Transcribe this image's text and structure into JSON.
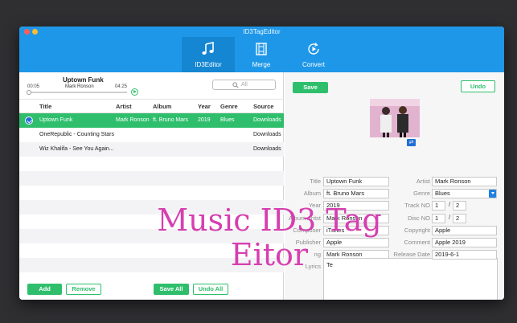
{
  "window": {
    "title": "ID3TagEditor"
  },
  "tabs": [
    {
      "label": "ID3Editor",
      "icon": "music-note-icon",
      "active": true
    },
    {
      "label": "Merge",
      "icon": "film-merge-icon",
      "active": false
    },
    {
      "label": "Convert",
      "icon": "convert-play-icon",
      "active": false
    }
  ],
  "player": {
    "title": "Uptown Funk",
    "artist": "Mark Ronson",
    "current_time": "00:05",
    "duration": "04:25",
    "progress": 0.02
  },
  "search": {
    "placeholder": "All"
  },
  "table": {
    "columns": [
      "Title",
      "Artist",
      "Album",
      "Year",
      "Genre",
      "Source"
    ],
    "rows": [
      {
        "title": "Uptown Funk",
        "artist": "Mark Ronson",
        "album": "ft. Bruno Mars",
        "year": "2019",
        "genre": "Blues",
        "source": "Downloads",
        "selected": true
      },
      {
        "title": "OneRepublic - Counting Stars",
        "artist": "",
        "album": "",
        "year": "",
        "genre": "",
        "source": "Downloads",
        "selected": false
      },
      {
        "title": "Wiz Khalifa - See You Again...",
        "artist": "",
        "album": "",
        "year": "",
        "genre": "",
        "source": "Downloads",
        "selected": false
      }
    ]
  },
  "bottom_buttons": {
    "add": "Add",
    "remove": "Remove",
    "save_all": "Save All",
    "undo_all": "Undo All"
  },
  "editor": {
    "save": "Save",
    "undo": "Undo",
    "fields": {
      "title": {
        "label": "Title",
        "value": "Uptown Funk"
      },
      "artist": {
        "label": "Artist",
        "value": "Mark Ronson"
      },
      "album": {
        "label": "Album",
        "value": "ft. Bruno Mars"
      },
      "genre": {
        "label": "Genre",
        "value": "Blues"
      },
      "year": {
        "label": "Year",
        "value": "2019"
      },
      "track_no": {
        "label": "Track NO",
        "value": "1",
        "total": "2"
      },
      "album_artist": {
        "label": "Album Aritst",
        "value": "Mark Ronson"
      },
      "disc_no": {
        "label": "Disc NO",
        "value": "1",
        "total": "2"
      },
      "composer": {
        "label": "Composer",
        "value": "iTunes"
      },
      "copyright": {
        "label": "Copyright",
        "value": "Apple"
      },
      "publisher": {
        "label": "Publisher",
        "value": "Apple"
      },
      "comment": {
        "label": "Comment",
        "value": "Apple 2019"
      },
      "encoding": {
        "label": "ng",
        "value": "Mark Ronson"
      },
      "release_date": {
        "label": "Release Date",
        "value": "2019-6-1"
      },
      "lyrics": {
        "label": "Lyrics",
        "value": "Te"
      }
    }
  },
  "watermark": {
    "line1": "Music ID3 Tag",
    "line2": "Eitor"
  },
  "colors": {
    "header_blue": "#1f97e8",
    "accent_green": "#2fbf6c",
    "watermark_pink": "#d63fb0"
  }
}
